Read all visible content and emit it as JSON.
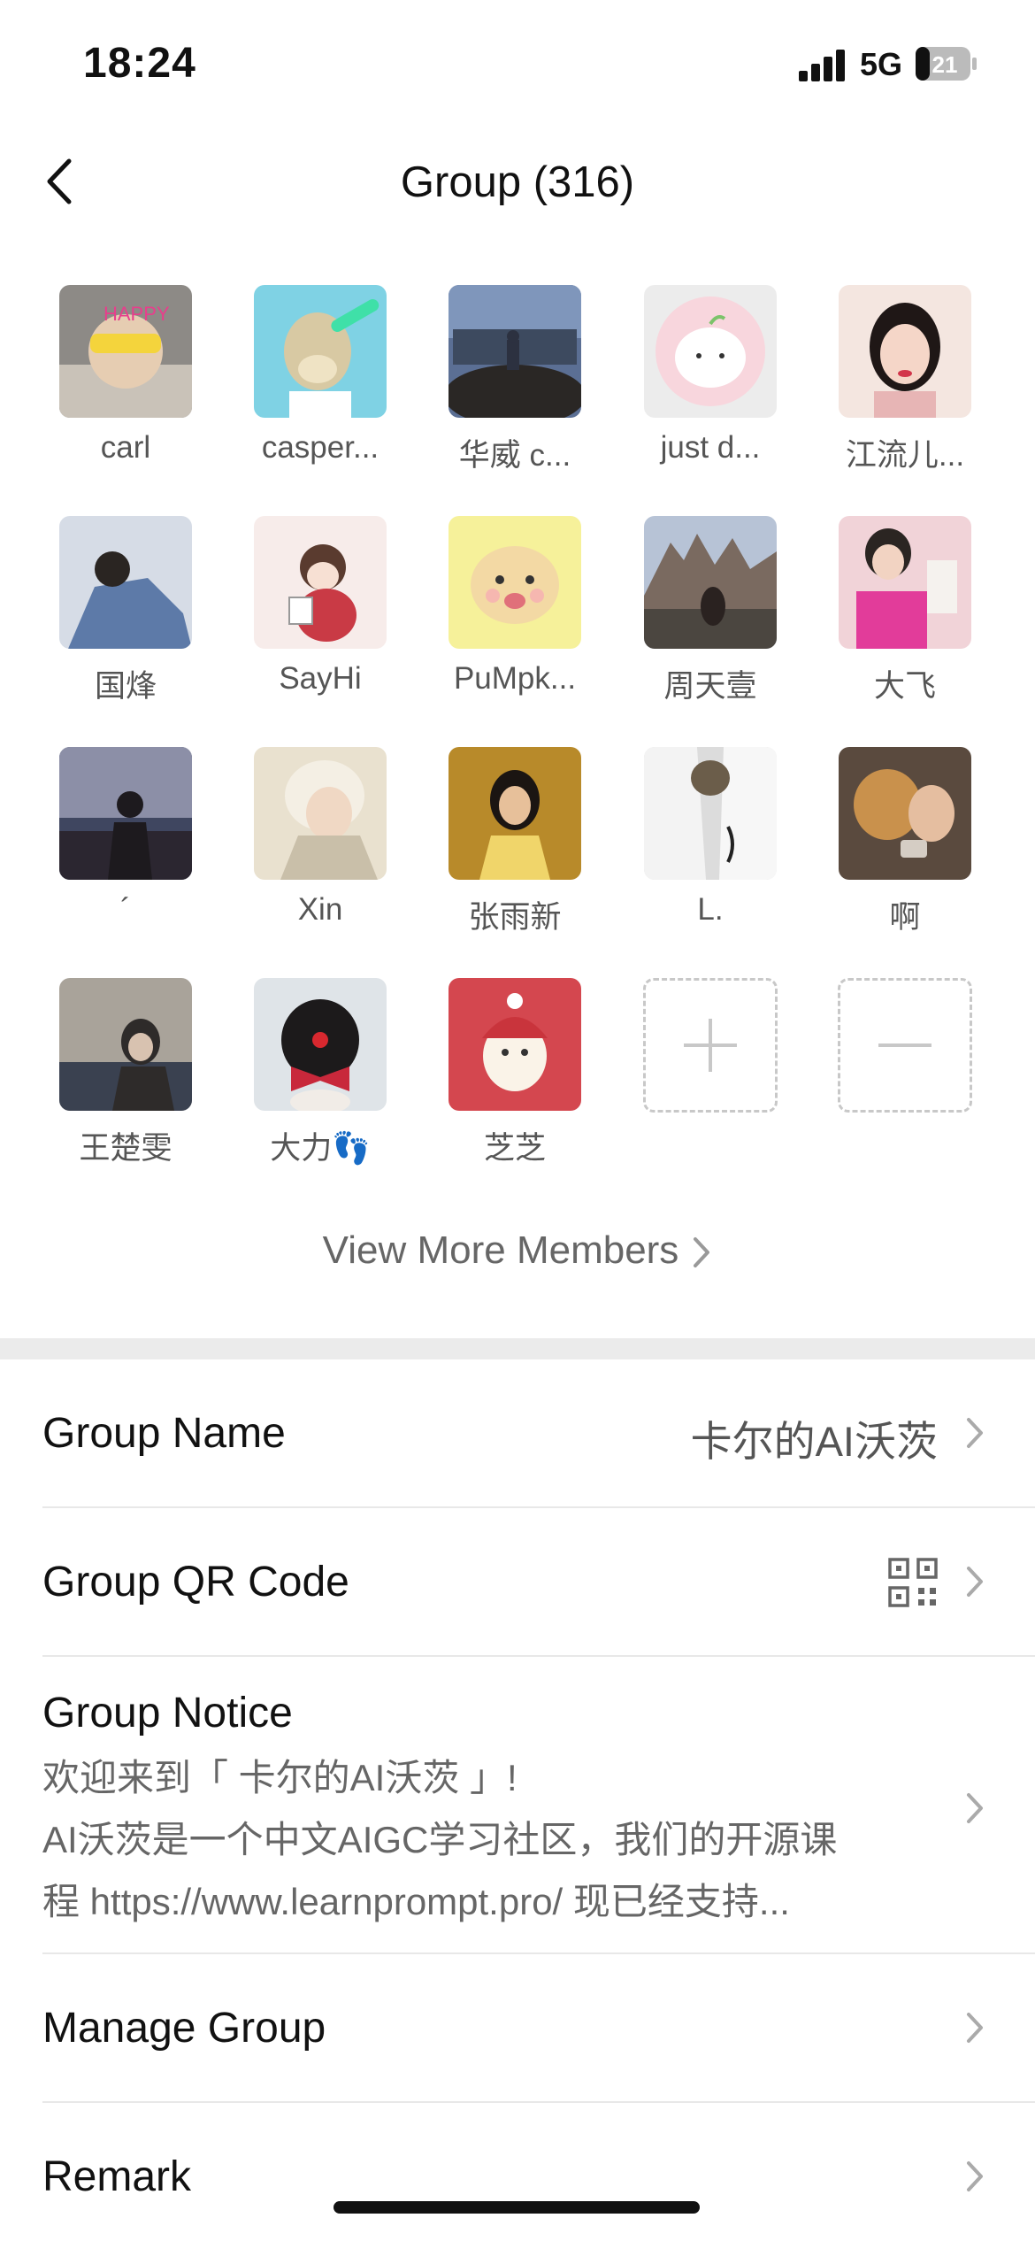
{
  "status": {
    "time": "18:24",
    "network": "5G",
    "battery": "21"
  },
  "header": {
    "title": "Group (316)"
  },
  "members": [
    {
      "name": "carl"
    },
    {
      "name": "casper..."
    },
    {
      "name": "华威 c..."
    },
    {
      "name": "just d..."
    },
    {
      "name": "江流儿..."
    },
    {
      "name": "国烽"
    },
    {
      "name": "SayHi"
    },
    {
      "name": "PuMpk..."
    },
    {
      "name": "周天壹"
    },
    {
      "name": "大飞"
    },
    {
      "name": "´"
    },
    {
      "name": "Xin"
    },
    {
      "name": "张雨新"
    },
    {
      "name": "L."
    },
    {
      "name": "啊"
    },
    {
      "name": "王楚雯"
    },
    {
      "name": "大力👣"
    },
    {
      "name": "芝芝"
    }
  ],
  "view_more": "View More Members",
  "rows": {
    "group_name": {
      "label": "Group Name",
      "value": "卡尔的AI沃茨"
    },
    "qr_code": {
      "label": "Group QR Code"
    },
    "notice": {
      "label": "Group Notice",
      "line1": "欢迎来到「 卡尔的AI沃茨 」!",
      "line2": "AI沃茨是一个中文AIGC学习社区，我们的开源课",
      "line3": "程 https://www.learnprompt.pro/ 现已经支持..."
    },
    "manage": {
      "label": "Manage Group"
    },
    "remark": {
      "label": "Remark"
    }
  }
}
